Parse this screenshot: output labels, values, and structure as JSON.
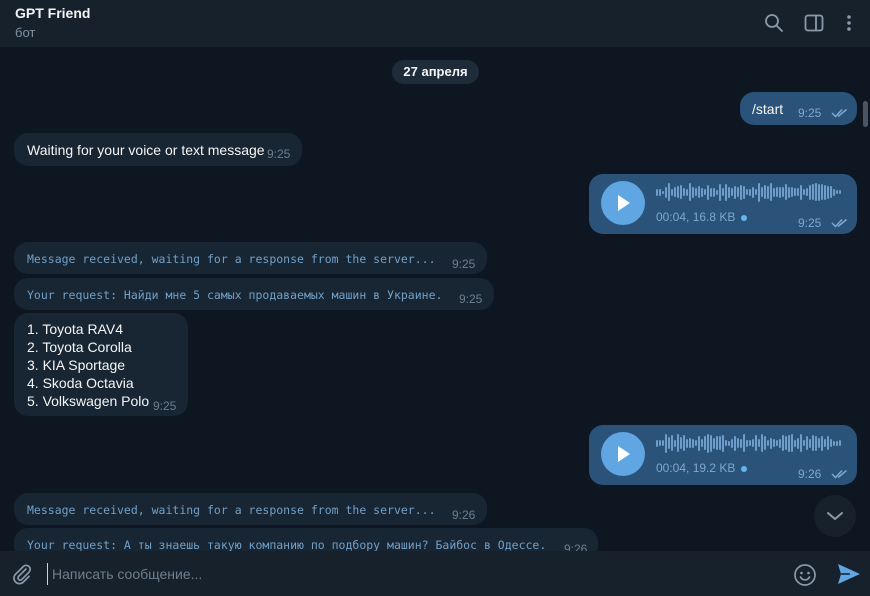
{
  "chat": {
    "title": "GPT Friend",
    "subtitle": "бот",
    "date_separator": "27 апреля"
  },
  "messages": {
    "m1": {
      "text": "/start",
      "time": "9:25"
    },
    "m2": {
      "text": "Waiting for your voice or text message",
      "time": "9:25"
    },
    "m3": {
      "duration_size": "00:04, 16.8 KB",
      "time": "9:25"
    },
    "m4": {
      "text": "Message received, waiting for a response from the server...",
      "time": "9:25"
    },
    "m5": {
      "text": "Your request: Найди мне 5 самых продаваемых машин в Украине.",
      "time": "9:25"
    },
    "m6": {
      "lines": [
        "1. Toyota RAV4",
        "2. Toyota Corolla",
        "3. KIA Sportage",
        "4. Skoda Octavia",
        "5. Volkswagen Polo"
      ],
      "time": "9:25"
    },
    "m7": {
      "duration_size": "00:04, 19.2 KB",
      "time": "9:26"
    },
    "m8": {
      "text": "Message received, waiting for a response from the server...",
      "time": "9:26"
    },
    "m9": {
      "text": "Your request: А ты знаешь такую компанию по подбору машин? Байбос в Одессе.",
      "time": "9:26"
    }
  },
  "composer": {
    "placeholder": "Написать сообщение..."
  },
  "icons": {
    "search": "search-icon",
    "sidebar": "sidebar-toggle-icon",
    "more": "more-vertical-icon",
    "attach": "paperclip-icon",
    "emoji": "emoji-icon",
    "send": "send-icon",
    "scroll_down": "chevron-down-icon",
    "play": "play-icon"
  },
  "colors": {
    "background": "#0e1621",
    "header": "#17212b",
    "incoming_bubble": "#182533",
    "outgoing_bubble": "#2b5278",
    "accent": "#5fa6e3"
  }
}
